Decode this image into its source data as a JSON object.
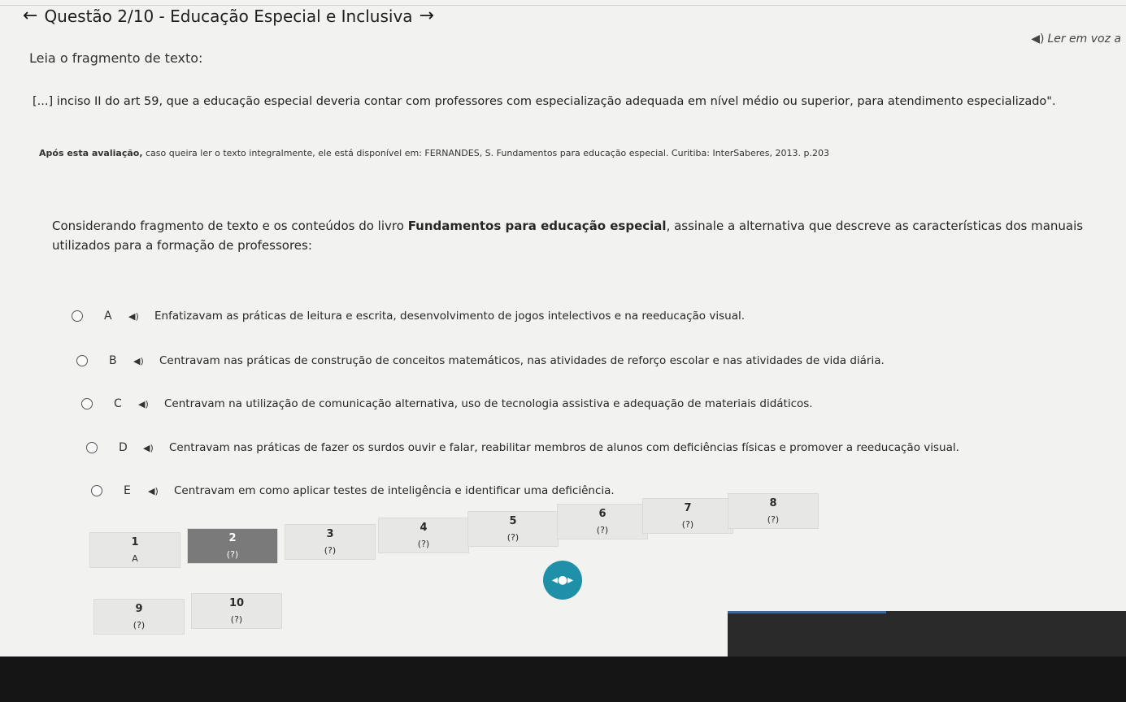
{
  "header": {
    "title": "Questão 2/10 - Educação Especial e Inclusiva",
    "back_icon": "arrow-left-icon",
    "next_icon": "arrow-right-icon"
  },
  "listen": {
    "label": "Ler em voz a",
    "icon": "speaker-icon"
  },
  "intro": "Leia o fragmento de texto:",
  "fragment": "[...] inciso II do art 59, que a educação especial deveria contar com professores com especialização adequada em nível médio ou superior, para atendimento especializado\".",
  "source": {
    "bold": "Após esta avaliação,",
    "text": " caso queira ler o texto integralmente, ele está disponível em: FERNANDES, S. Fundamentos para educação especial. Curitiba: InterSaberes, 2013. p.203"
  },
  "question": {
    "part1": "Considerando fragmento de texto e os conteúdos do livro ",
    "book": "Fundamentos para educação especial",
    "part2": ", assinale a alternativa que descreve as características dos manuais utilizados para a formação de professores:"
  },
  "alternatives": [
    {
      "letter": "A",
      "text": "Enfatizavam as práticas de leitura e escrita, desenvolvimento de jogos intelectivos e na reeducação visual."
    },
    {
      "letter": "B",
      "text": "Centravam nas práticas de construção de conceitos matemáticos, nas atividades de reforço escolar e nas atividades de vida diária."
    },
    {
      "letter": "C",
      "text": "Centravam na utilização de comunicação alternativa, uso de tecnologia assistiva e adequação de materiais didáticos."
    },
    {
      "letter": "D",
      "text": "Centravam nas práticas de fazer os surdos ouvir e falar, reabilitar membros de alunos com deficiências físicas e promover a reeducação visual."
    },
    {
      "letter": "E",
      "text": "Centravam em como aplicar testes de inteligência e identificar uma deficiência."
    }
  ],
  "navigator": {
    "questions": [
      {
        "num": "1",
        "status": "A"
      },
      {
        "num": "2",
        "status": "(?)"
      },
      {
        "num": "3",
        "status": "(?)"
      },
      {
        "num": "4",
        "status": "(?)"
      },
      {
        "num": "5",
        "status": "(?)"
      },
      {
        "num": "6",
        "status": "(?)"
      },
      {
        "num": "7",
        "status": "(?)"
      },
      {
        "num": "8",
        "status": "(?)"
      },
      {
        "num": "9",
        "status": "(?)"
      },
      {
        "num": "10",
        "status": "(?)"
      }
    ]
  }
}
